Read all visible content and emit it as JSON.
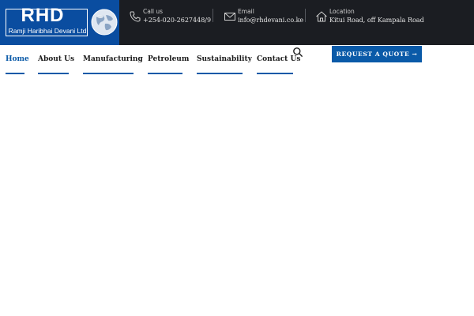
{
  "logo": {
    "text": "RHD",
    "company": "Ramji Haribhai Devani Ltd",
    "icon": "globe-icon"
  },
  "contacts": [
    {
      "label": "Call us",
      "value": "+254-020-2627448/9",
      "icon": "phone-icon"
    },
    {
      "label": "Email",
      "value": "info@rhdevani.co.ke",
      "icon": "mail-icon"
    },
    {
      "label": "Location",
      "value": "Kitui Road, off Kampala Road",
      "icon": "home-icon"
    }
  ],
  "nav": {
    "items": [
      "Home",
      "About Us",
      "Manufacturing",
      "Petroleum",
      "Sustainability",
      "Contact Us"
    ],
    "active": "Home"
  },
  "search": {
    "icon": "search-icon"
  },
  "cta": {
    "label": "REQUEST A QUOTE →"
  },
  "colors": {
    "topbar": "#1b1d22",
    "brand_blue": "#0a5aa8",
    "logo_blue": "#0a4da0",
    "nav_text": "#1a1a1a"
  }
}
